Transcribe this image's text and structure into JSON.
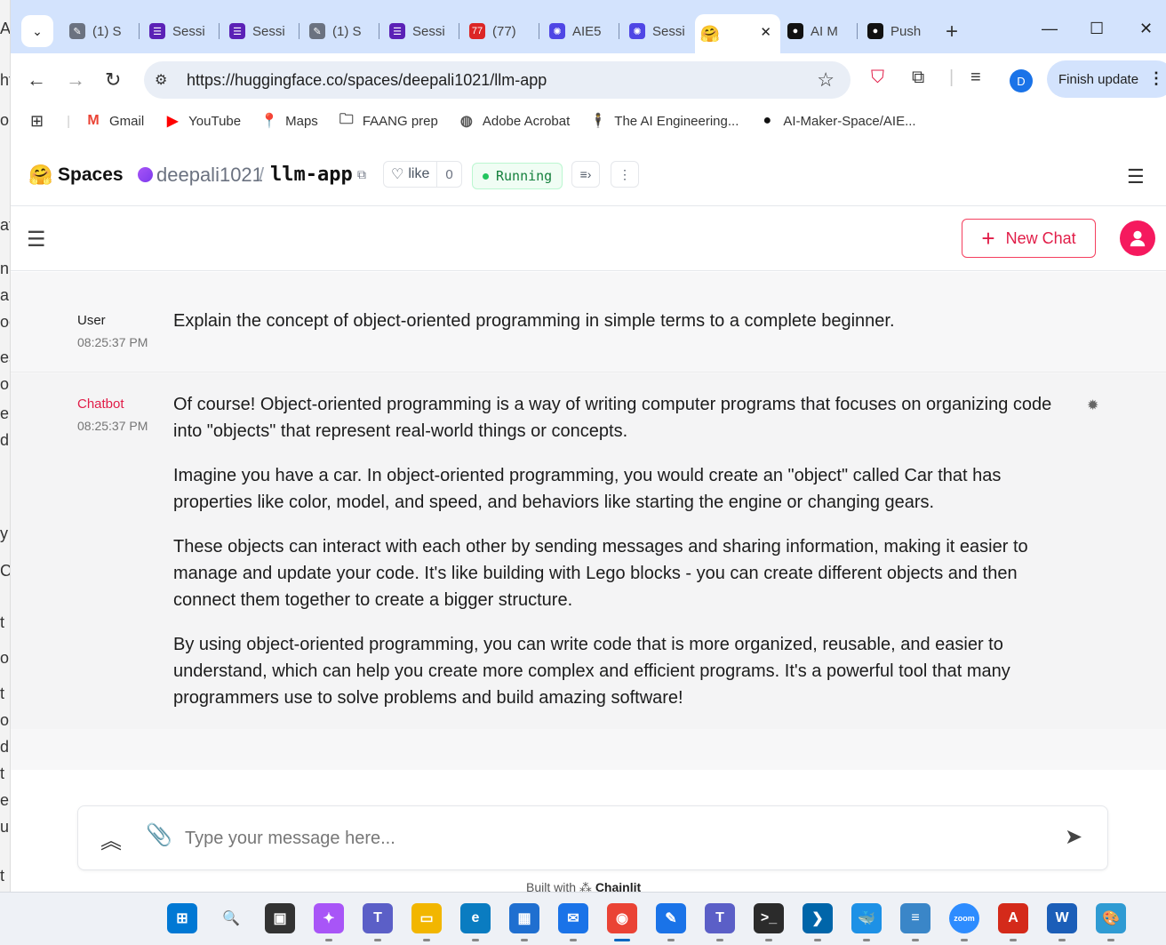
{
  "behind_window_chars": [
    "A",
    "ht",
    "o",
    "at",
    "n",
    "ap",
    "oc",
    "es",
    "o",
    "e",
    "d",
    "y",
    "C",
    "t",
    "ol",
    "t",
    "or",
    "d",
    "t",
    "el",
    "ui",
    "t"
  ],
  "tabs": [
    {
      "label": "(1) S",
      "icon": "magic-wand-icon",
      "color": "#6b7280"
    },
    {
      "label": "Sessi",
      "icon": "list-icon",
      "color": "#5b21b6"
    },
    {
      "label": "Sessi",
      "icon": "list-icon",
      "color": "#5b21b6"
    },
    {
      "label": "(1) S",
      "icon": "magic-wand-icon",
      "color": "#6b7280"
    },
    {
      "label": "Sessi",
      "icon": "list-icon",
      "color": "#5b21b6"
    },
    {
      "label": "(77)",
      "icon": "notification-icon",
      "color": "#dc2626"
    },
    {
      "label": "AIE5",
      "icon": "star-burst-icon",
      "color": "#4f46e5"
    },
    {
      "label": "Sessi",
      "icon": "star-burst-icon",
      "color": "#4f46e5"
    },
    {
      "label": "",
      "icon": "hugging-face-icon",
      "color": "#fbbf24",
      "active": true
    },
    {
      "label": "AI M",
      "icon": "github-icon",
      "color": "#111111"
    },
    {
      "label": "Push",
      "icon": "github-icon",
      "color": "#111111"
    }
  ],
  "address": {
    "url": "https://huggingface.co/spaces/deepali1021/llm-app"
  },
  "profile_initial": "D",
  "finish_update": "Finish update",
  "bookmarks": [
    {
      "label": "Gmail",
      "icon": "gmail-icon"
    },
    {
      "label": "YouTube",
      "icon": "youtube-icon"
    },
    {
      "label": "Maps",
      "icon": "maps-icon"
    },
    {
      "label": "FAANG prep",
      "icon": "folder-icon"
    },
    {
      "label": "Adobe Acrobat",
      "icon": "globe-icon"
    },
    {
      "label": "The AI Engineering...",
      "icon": "person-icon"
    },
    {
      "label": "AI-Maker-Space/AIE...",
      "icon": "github-icon"
    }
  ],
  "hf": {
    "spaces": "Spaces",
    "owner": "deepali1021",
    "slash": "/",
    "repo": "llm-app",
    "like_label": "like",
    "like_count": "0",
    "status": "Running"
  },
  "app": {
    "new_chat": "New Chat",
    "messages": [
      {
        "author": "User",
        "time": "08:25:37 PM",
        "author_color": "#1c1c1c",
        "paragraphs": [
          "Explain the concept of object-oriented programming in simple terms to a complete beginner."
        ]
      },
      {
        "author": "Chatbot",
        "time": "08:25:37 PM",
        "author_color": "#e11d48",
        "paragraphs": [
          "Of course! Object-oriented programming is a way of writing computer programs that focuses on organizing code into \"objects\" that represent real-world things or concepts.",
          "Imagine you have a car. In object-oriented programming, you would create an \"object\" called Car that has properties like color, model, and speed, and behaviors like starting the engine or changing gears.",
          "These objects can interact with each other by sending messages and sharing information, making it easier to manage and update your code. It's like building with Lego blocks - you can create different objects and then connect them together to create a bigger structure.",
          "By using object-oriented programming, you can write code that is more organized, reusable, and easier to understand, which can help you create more complex and efficient programs. It's a powerful tool that many programmers use to solve problems and build amazing software!"
        ]
      }
    ],
    "composer_placeholder": "Type your message here...",
    "built_with": "Built with",
    "built_with_brand": "Chainlit"
  },
  "taskbar": [
    {
      "name": "start-icon",
      "color": "#0078d4",
      "glyph": "⊞"
    },
    {
      "name": "search-icon",
      "color": "transparent",
      "glyph": "🔍"
    },
    {
      "name": "task-view-icon",
      "color": "#333333",
      "glyph": "▣"
    },
    {
      "name": "copilot-icon",
      "color": "#a855f7",
      "glyph": "✦"
    },
    {
      "name": "teams-icon",
      "color": "#5b5fc7",
      "glyph": "T"
    },
    {
      "name": "file-explorer-icon",
      "color": "#f2b600",
      "glyph": "▭"
    },
    {
      "name": "edge-icon",
      "color": "#0a7cc1",
      "glyph": "e"
    },
    {
      "name": "store-icon",
      "color": "#1f6fd0",
      "glyph": "▦"
    },
    {
      "name": "mail-icon",
      "color": "#1a73e8",
      "glyph": "✉"
    },
    {
      "name": "chrome-icon",
      "color": "#ea4335",
      "glyph": "◉",
      "active": true
    },
    {
      "name": "tool-icon",
      "color": "#1a73e8",
      "glyph": "✎"
    },
    {
      "name": "teams-icon",
      "color": "#5b5fc7",
      "glyph": "T"
    },
    {
      "name": "terminal-icon",
      "color": "#2b2b2b",
      "glyph": ">_"
    },
    {
      "name": "vscode-icon",
      "color": "#0065a9",
      "glyph": "❯"
    },
    {
      "name": "docker-icon",
      "color": "#1d91e6",
      "glyph": "🐳"
    },
    {
      "name": "notepad-icon",
      "color": "#3a86c8",
      "glyph": "≡"
    },
    {
      "name": "zoom-icon",
      "color": "#2d8cff",
      "glyph": "zoom"
    },
    {
      "name": "acrobat-icon",
      "color": "#d42a1a",
      "glyph": "A"
    },
    {
      "name": "word-icon",
      "color": "#1b5eb8",
      "glyph": "W"
    },
    {
      "name": "paint-icon",
      "color": "#2f9bd3",
      "glyph": "🎨"
    }
  ]
}
